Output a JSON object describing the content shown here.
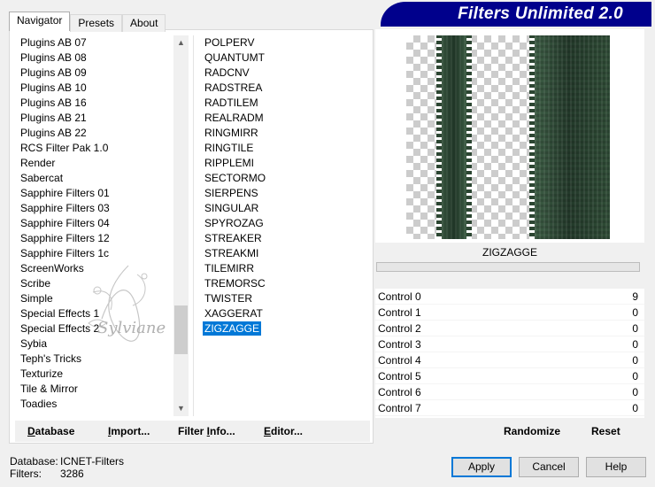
{
  "tabs": [
    {
      "label": "Navigator",
      "active": true
    },
    {
      "label": "Presets",
      "active": false
    },
    {
      "label": "About",
      "active": false
    }
  ],
  "banner": {
    "title": "Filters Unlimited 2.0",
    "color": "#00008c"
  },
  "categories": [
    "Plugins AB 07",
    "Plugins AB 08",
    "Plugins AB 09",
    "Plugins AB 10",
    "Plugins AB 16",
    "Plugins AB 21",
    "Plugins AB 22",
    "RCS Filter Pak 1.0",
    "Render",
    "Sabercat",
    "Sapphire Filters 01",
    "Sapphire Filters 03",
    "Sapphire Filters 04",
    "Sapphire Filters 12",
    "Sapphire Filters 1c",
    "ScreenWorks",
    "Scribe",
    "Simple",
    "Special Effects 1",
    "Special Effects 2",
    "Sybia",
    "Teph's Tricks",
    "Texturize",
    "Tile & Mirror",
    "Toadies"
  ],
  "filters": [
    "POLPERV",
    "QUANTUMT",
    "RADCNV",
    "RADSTREA",
    "RADTILEM",
    "REALRADM",
    "RINGMIRR",
    "RINGTILE",
    "RIPPLEMI",
    "SECTORMO",
    "SIERPENS",
    "SINGULAR",
    "SPYROZAG",
    "STREAKER",
    "STREAKMI",
    "TILEMIRR",
    "TREMORSC",
    "TWISTER",
    "XAGGERAT",
    "ZIGZAGGE"
  ],
  "selected_filter": "ZIGZAGGE",
  "selected_color": "#0078d7",
  "panel_buttons": {
    "database": {
      "label": "Database",
      "underline": "D",
      "rest": "atabase"
    },
    "import": {
      "underline": "I",
      "rest": "mport..."
    },
    "filter_info": {
      "pre": "Filter ",
      "underline": "I",
      "rest": "nfo..."
    },
    "editor": {
      "underline": "E",
      "rest": "ditor..."
    }
  },
  "preview": {
    "filter_name": "ZIGZAGGE",
    "progress": 0
  },
  "controls": [
    {
      "label": "Control 0",
      "value": "9"
    },
    {
      "label": "Control 1",
      "value": "0"
    },
    {
      "label": "Control 2",
      "value": "0"
    },
    {
      "label": "Control 3",
      "value": "0"
    },
    {
      "label": "Control 4",
      "value": "0"
    },
    {
      "label": "Control 5",
      "value": "0"
    },
    {
      "label": "Control 6",
      "value": "0"
    },
    {
      "label": "Control 7",
      "value": "0"
    }
  ],
  "actions": {
    "randomize": "Randomize",
    "reset": "Reset"
  },
  "status": {
    "database_label": "Database:",
    "database_value": "ICNET-Filters",
    "filters_label": "Filters:",
    "filters_value": "3286"
  },
  "dialog": {
    "apply": "Apply",
    "cancel": "Cancel",
    "help": "Help"
  },
  "watermark": {
    "text": "Sylviane"
  }
}
